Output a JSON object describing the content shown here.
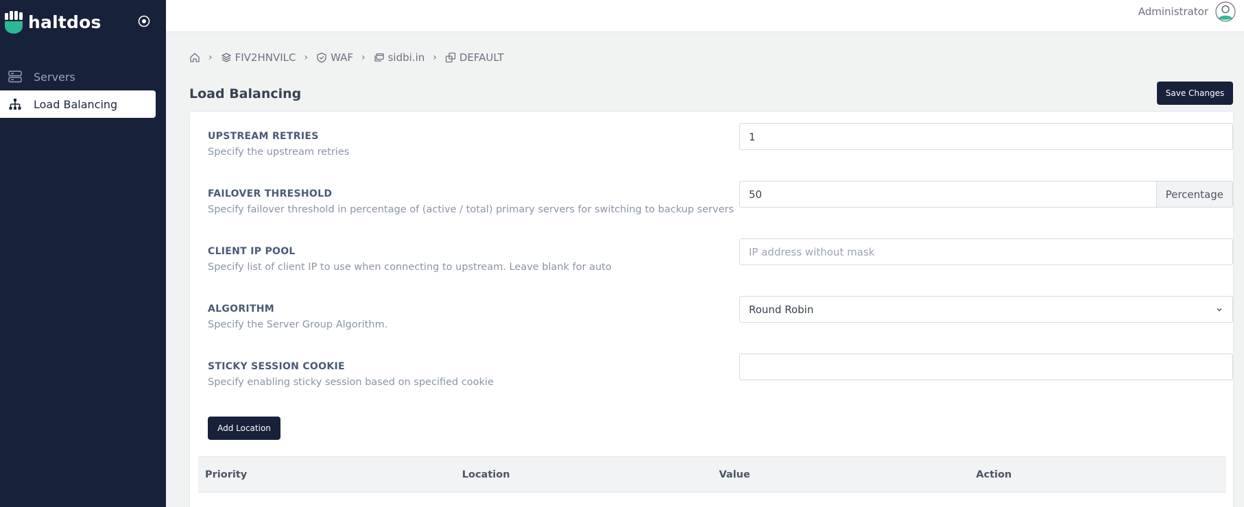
{
  "brand": {
    "name": "haltdos"
  },
  "sidebar": {
    "items": [
      {
        "label": "Servers",
        "icon": "server-icon",
        "active": false
      },
      {
        "label": "Load Balancing",
        "icon": "sitemap-icon",
        "active": true
      }
    ]
  },
  "header": {
    "user_name": "Administrator"
  },
  "breadcrumb": [
    "FIV2HNVILC",
    "WAF",
    "sidbi.in",
    "DEFAULT"
  ],
  "page": {
    "title": "Load Balancing",
    "save_label": "Save Changes"
  },
  "form": {
    "upstream_retries": {
      "label": "UPSTREAM RETRIES",
      "desc": "Specify the upstream retries",
      "value": "1"
    },
    "failover_threshold": {
      "label": "FAILOVER THRESHOLD",
      "desc": "Specify failover threshold in percentage of (active / total) primary servers for switching to backup servers",
      "value": "50",
      "unit": "Percentage"
    },
    "client_ip_pool": {
      "label": "CLIENT IP POOL",
      "desc": "Specify list of client IP to use when connecting to upstream. Leave blank for auto",
      "value": "",
      "placeholder": "IP address without mask"
    },
    "algorithm": {
      "label": "ALGORITHM",
      "desc": "Specify the Server Group Algorithm.",
      "value": "Round Robin"
    },
    "sticky_session_cookie": {
      "label": "STICKY SESSION COOKIE",
      "desc": "Specify enabling sticky session based on specified cookie",
      "value": ""
    }
  },
  "add_location_label": "Add Location",
  "table": {
    "columns": [
      "Priority",
      "Location",
      "Value",
      "Action"
    ]
  },
  "colors": {
    "sidebar_bg": "#18213a",
    "accent_green": "#2bb894",
    "button_dark": "#18213a"
  }
}
